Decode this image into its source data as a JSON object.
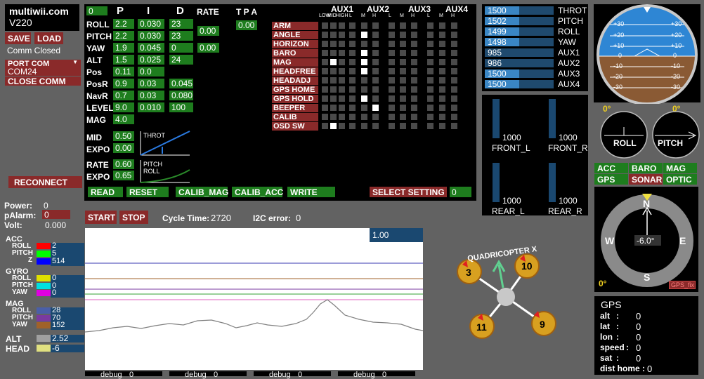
{
  "app": {
    "title": "multiwii.com",
    "version": "V220"
  },
  "left": {
    "save": "SAVE",
    "load": "LOAD",
    "comm_status": "Comm Closed",
    "port_com": "PORT COM",
    "com_selected": "COM24",
    "close_comm": "CLOSE COMM",
    "reconnect": "RECONNECT",
    "power_label": "Power:",
    "power_val": "0",
    "palarm_label": "pAlarm:",
    "palarm_val": "0",
    "volt_label": "Volt:",
    "volt_val": "0.000"
  },
  "pid": {
    "header_box": "0",
    "col_p": "P",
    "col_i": "I",
    "col_d": "D",
    "col_rate": "RATE",
    "col_tpa": "T P A",
    "rows": [
      {
        "name": "ROLL",
        "p": "2.2",
        "i": "0.030",
        "d": "23"
      },
      {
        "name": "PITCH",
        "p": "2.2",
        "i": "0.030",
        "d": "23"
      },
      {
        "name": "YAW",
        "p": "1.9",
        "i": "0.045",
        "d": "0"
      },
      {
        "name": "ALT",
        "p": "1.5",
        "i": "0.025",
        "d": "24"
      },
      {
        "name": "Pos",
        "p": "0.11",
        "i": "0.0",
        "d": ""
      },
      {
        "name": "PosR",
        "p": "0.9",
        "i": "0.03",
        "d": "0.045"
      },
      {
        "name": "NavR",
        "p": "0.7",
        "i": "0.03",
        "d": "0.080"
      },
      {
        "name": "LEVEL",
        "p": "9.0",
        "i": "0.010",
        "d": "100"
      },
      {
        "name": "MAG",
        "p": "4.0",
        "i": "",
        "d": ""
      }
    ],
    "rate_rollpitch": "0.00",
    "rate_yaw": "0.00",
    "tpa": "0.00",
    "mid_label": "MID",
    "mid_val": "0.50",
    "expo_label": "EXPO",
    "expo_val": "0.00",
    "rate_label": "RATE",
    "rate_val": "0.60",
    "expo2_label": "EXPO",
    "expo2_val": "0.65",
    "throt_graph": "THROT",
    "pitch_graph": "PITCH",
    "roll_graph": "ROLL",
    "read": "READ",
    "reset": "RESET",
    "calib_mag": "CALIB_MAG",
    "calib_acc": "CALIB_ACC",
    "write": "WRITE",
    "select_setting": "SELECT SETTING",
    "setting_val": "0"
  },
  "aux": {
    "headers": [
      "AUX1",
      "AUX2",
      "AUX3",
      "AUX4"
    ],
    "sub_aux1": [
      "LOW",
      "MID",
      "HIGH"
    ],
    "sub_other": [
      "L",
      "M",
      "H"
    ],
    "boxes": [
      {
        "name": "ARM",
        "on": []
      },
      {
        "name": "ANGLE",
        "on": [
          4
        ]
      },
      {
        "name": "HORIZON",
        "on": []
      },
      {
        "name": "BARO",
        "on": [
          4
        ]
      },
      {
        "name": "MAG",
        "on": [
          1,
          4
        ]
      },
      {
        "name": "HEADFREE",
        "on": [
          4
        ]
      },
      {
        "name": "HEADADJ",
        "on": []
      },
      {
        "name": "GPS HOME",
        "on": []
      },
      {
        "name": "GPS HOLD",
        "on": [
          4
        ]
      },
      {
        "name": "BEEPER",
        "on": [
          5
        ]
      },
      {
        "name": "CALIB",
        "on": []
      },
      {
        "name": "OSD SW",
        "on": [
          1
        ]
      }
    ]
  },
  "rc": [
    {
      "val": "1500",
      "name": "THROT",
      "frac": 0.5
    },
    {
      "val": "1502",
      "name": "PITCH",
      "frac": 0.5
    },
    {
      "val": "1499",
      "name": "ROLL",
      "frac": 0.5
    },
    {
      "val": "1498",
      "name": "YAW",
      "frac": 0.5
    },
    {
      "val": "985",
      "name": "AUX1",
      "frac": 0.0
    },
    {
      "val": "986",
      "name": "AUX2",
      "frac": 0.0
    },
    {
      "val": "1500",
      "name": "AUX3",
      "frac": 0.5
    },
    {
      "val": "1500",
      "name": "AUX4",
      "frac": 0.5
    }
  ],
  "motors": [
    {
      "val": "1000",
      "name": "FRONT_L"
    },
    {
      "val": "1000",
      "name": "FRONT_R"
    },
    {
      "val": "1000",
      "name": "REAR_L"
    },
    {
      "val": "1000",
      "name": "REAR_R"
    }
  ],
  "horizon": {
    "ticks": [
      "+30",
      "+20",
      "+10",
      "0",
      "-10",
      "-20",
      "-30"
    ],
    "roll_deg": "0°",
    "pitch_deg": "0°",
    "roll": "ROLL",
    "pitch": "PITCH"
  },
  "sensors": {
    "acc": "ACC",
    "baro": "BARO",
    "mag": "MAG",
    "gps": "GPS",
    "sonar": "SONAR",
    "optic": "OPTIC"
  },
  "compass": {
    "n": "N",
    "s": "S",
    "e": "E",
    "w": "W",
    "heading": "-6.0°",
    "zero": "0°",
    "gps_fix": "GPS_fix"
  },
  "gps": {
    "title": "GPS",
    "rows": [
      {
        "label": "alt",
        "val": "0"
      },
      {
        "label": "lat",
        "val": "0"
      },
      {
        "label": "lon",
        "val": "0"
      },
      {
        "label": "speed",
        "val": "0"
      },
      {
        "label": "sat",
        "val": "0"
      },
      {
        "label": "dist home",
        "val": "0"
      }
    ]
  },
  "graph": {
    "start": "START",
    "stop": "STOP",
    "cycle_label": "Cycle Time:",
    "cycle_val": "2720",
    "i2c_label": "I2C error:",
    "i2c_val": "0",
    "scale": "1.00",
    "debug_label": "debug",
    "debug_vals": [
      "0",
      "0",
      "0",
      "0"
    ]
  },
  "legend": {
    "acc": "ACC",
    "gyro": "GYRO",
    "mag": "MAG",
    "alt": "ALT",
    "head": "HEAD",
    "roll": "ROLL",
    "pitch": "PITCH",
    "yaw": "YAW",
    "z": "Z",
    "acc_vals": [
      "2",
      "5",
      "514"
    ],
    "gyro_vals": [
      "0",
      "0",
      "0"
    ],
    "mag_vals": [
      "28",
      "70",
      "152"
    ],
    "alt_val": "2.52",
    "head_val": "-6"
  },
  "quad": {
    "label": "QUADRICOPTER X",
    "motors": [
      "3",
      "10",
      "11",
      "9"
    ]
  }
}
